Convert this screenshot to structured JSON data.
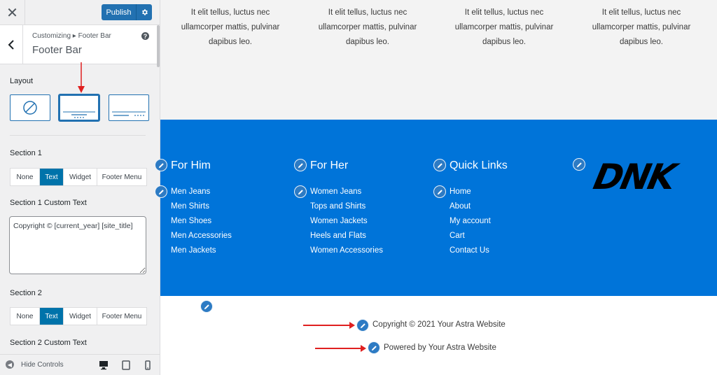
{
  "topbar": {
    "close_glyph": "✕",
    "publish_label": "Publish",
    "gear_icon": "gear-icon"
  },
  "panel": {
    "breadcrumb": "Customizing ▸ Footer Bar",
    "title": "Footer Bar",
    "help_glyph": "?"
  },
  "layout": {
    "label": "Layout",
    "options": [
      "disabled",
      "layout-1",
      "layout-2"
    ],
    "selected": "layout-1"
  },
  "section1": {
    "label": "Section 1",
    "buttons": [
      "None",
      "Text",
      "Widget",
      "Footer Menu"
    ],
    "active": "Text",
    "custom_text_label": "Section 1 Custom Text",
    "custom_text_value": "Copyright © [current_year] [site_title]"
  },
  "section2": {
    "label": "Section 2",
    "buttons": [
      "None",
      "Text",
      "Widget",
      "Footer Menu"
    ],
    "active": "Text",
    "custom_text_label": "Section 2 Custom Text"
  },
  "bottombar": {
    "hide_controls_label": "Hide Controls",
    "devices": [
      "desktop",
      "tablet",
      "mobile"
    ]
  },
  "preview": {
    "gray_text": "It elit tellus, luctus nec ullamcorper mattis, pulvinar dapibus leo.",
    "columns": [
      {
        "title": "For Him",
        "links": [
          "Men Jeans",
          "Men Shirts",
          "Men Shoes",
          "Men Accessories",
          "Men Jackets"
        ]
      },
      {
        "title": "For Her",
        "links": [
          "Women Jeans",
          "Tops and Shirts",
          "Women Jackets",
          "Heels and Flats",
          "Women Accessories"
        ]
      },
      {
        "title": "Quick Links",
        "links": [
          "Home",
          "About",
          "My account",
          "Cart",
          "Contact Us"
        ]
      }
    ],
    "logo_text": "DNK",
    "copyright": "Copyright © 2021 Your Astra Website",
    "powered_by": "Powered by Your Astra Website"
  },
  "colors": {
    "accent": "#2271b1",
    "footer_blue": "#0074d9",
    "annotation_red": "#e02020",
    "active_button": "#0073aa"
  }
}
